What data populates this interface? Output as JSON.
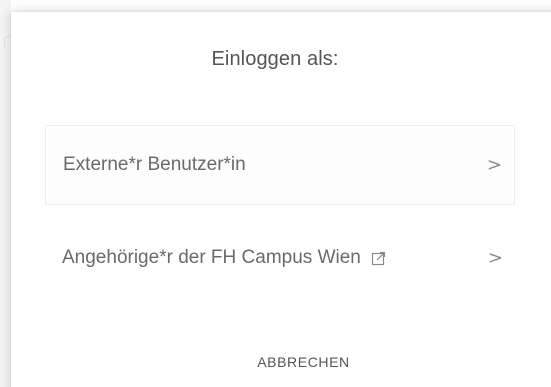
{
  "dialog": {
    "title": "Einloggen als:",
    "options": [
      {
        "label": "Externe*r Benutzer*in",
        "chevron": ">",
        "chevron_icon": "chevron-right-icon"
      },
      {
        "label": "Angehörige*r der FH Campus Wien",
        "external_icon": "external-link-icon",
        "chevron": ">",
        "chevron_icon": "chevron-right-icon"
      }
    ],
    "cancel_label": "ABBRECHEN"
  },
  "colors": {
    "text": "#555555",
    "option_text": "#6a6a6a",
    "option_border": "#ececec"
  }
}
